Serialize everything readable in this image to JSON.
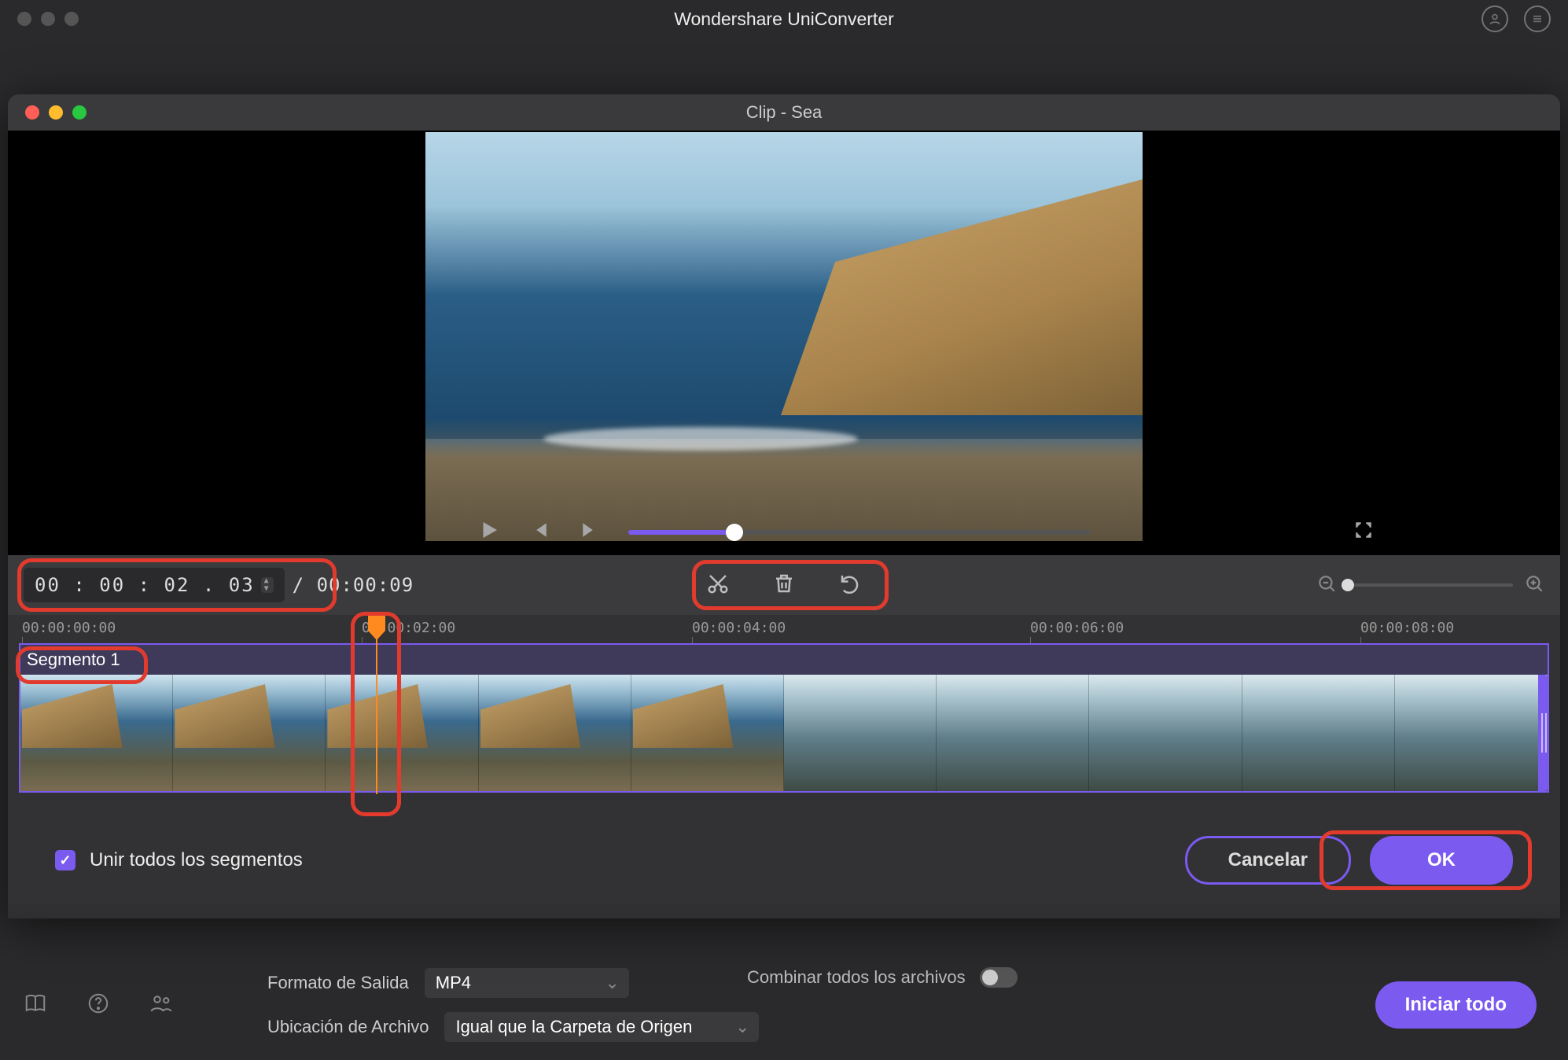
{
  "main_window": {
    "title": "Wondershare UniConverter"
  },
  "modal": {
    "title": "Clip - Sea",
    "timecode": {
      "current": "00 : 00 : 02 . 03",
      "total": "/ 00:00:09"
    },
    "segment_label": "Segmento 1",
    "ruler": {
      "t0": "00:00:00:00",
      "t1": "00:00:02:00",
      "t2": "00:00:04:00",
      "t3": "00:00:06:00",
      "t4": "00:00:08:00"
    },
    "merge_label": "Unir todos los segmentos",
    "buttons": {
      "cancel": "Cancelar",
      "ok": "OK"
    }
  },
  "footer": {
    "output_format_label": "Formato de Salida",
    "output_format_value": "MP4",
    "file_location_label": "Ubicación de Archivo",
    "file_location_value": "Igual que la Carpeta de Origen",
    "combine_label": "Combinar todos los archivos",
    "start_all": "Iniciar todo"
  }
}
